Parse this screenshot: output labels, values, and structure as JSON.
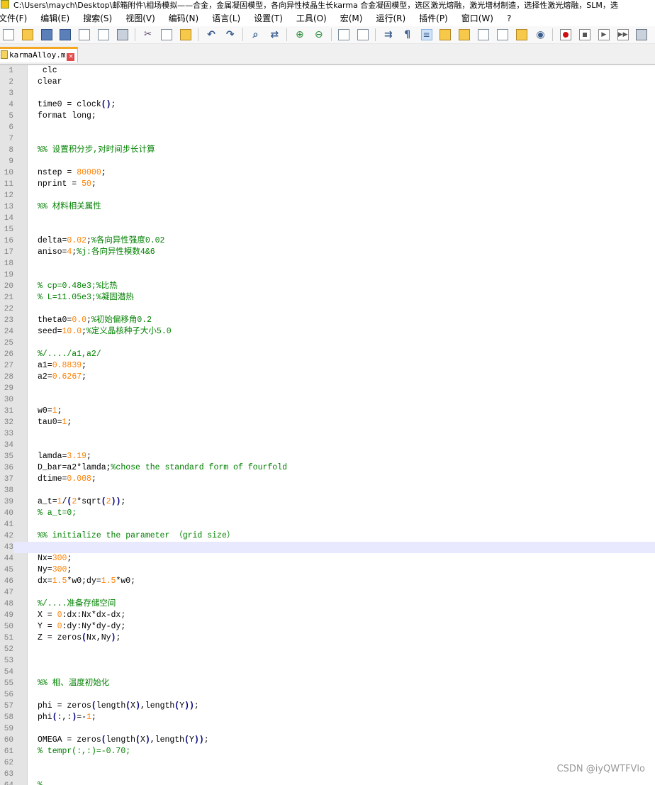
{
  "window": {
    "title": "C:\\Users\\maych\\Desktop\\邮箱附件\\相场模拟——合金，金属凝固模型，各向异性枝晶生长karma 合金凝固模型，选区激光熔融，激光增材制造，选择性激光熔融，SLM，选"
  },
  "menu": [
    "文件(F)",
    "编辑(E)",
    "搜索(S)",
    "视图(V)",
    "编码(N)",
    "语言(L)",
    "设置(T)",
    "工具(O)",
    "宏(M)",
    "运行(R)",
    "插件(P)",
    "窗口(W)",
    "?"
  ],
  "toolbar_icons": [
    "new-file-icon",
    "open-file-icon",
    "save-icon",
    "save-all-icon",
    "close-icon",
    "close-all-icon",
    "print-icon",
    "cut-icon",
    "copy-icon",
    "paste-icon",
    "undo-icon",
    "redo-icon",
    "find-icon",
    "replace-icon",
    "zoom-in-icon",
    "zoom-out-icon",
    "sync-vertical-icon",
    "sync-horizontal-icon",
    "word-wrap-icon",
    "show-all-chars-icon",
    "indent-guide-icon",
    "user-lang-icon",
    "doc-map-icon",
    "function-list-icon",
    "folder-workspace-icon",
    "monitor-icon",
    "record-macro-icon",
    "stop-macro-icon",
    "play-macro-icon",
    "play-multiple-icon",
    "save-macro-icon"
  ],
  "tab": {
    "filename": "karmaAlloy.m",
    "close": "×"
  },
  "editor": {
    "current_line": 43,
    "lines": [
      {
        "n": "1",
        "t": " clc"
      },
      {
        "n": "2",
        "t": "clear"
      },
      {
        "n": "3",
        "t": ""
      },
      {
        "n": "4",
        "t": "time0 = clock();"
      },
      {
        "n": "5",
        "t": "format long;"
      },
      {
        "n": "6",
        "t": ""
      },
      {
        "n": "7",
        "t": ""
      },
      {
        "n": "8",
        "t": "%% 设置积分步,对时间步长计算"
      },
      {
        "n": "9",
        "t": ""
      },
      {
        "n": "10",
        "t": "nstep = 80000;"
      },
      {
        "n": "11",
        "t": "nprint = 50;"
      },
      {
        "n": "12",
        "t": ""
      },
      {
        "n": "13",
        "t": "%% 材料相关属性"
      },
      {
        "n": "14",
        "t": ""
      },
      {
        "n": "15",
        "t": ""
      },
      {
        "n": "16",
        "t": "delta=0.02;%各向异性强度0.02"
      },
      {
        "n": "17",
        "t": "aniso=4;%j:各向异性模数4&6"
      },
      {
        "n": "18",
        "t": ""
      },
      {
        "n": "19",
        "t": ""
      },
      {
        "n": "20",
        "t": "% cp=0.48e3;%比热"
      },
      {
        "n": "21",
        "t": "% L=11.05e3;%凝固潜热"
      },
      {
        "n": "22",
        "t": ""
      },
      {
        "n": "23",
        "t": "theta0=0.0;%初始偏移角0.2"
      },
      {
        "n": "24",
        "t": "seed=10.0;%定义晶核种子大小5.0"
      },
      {
        "n": "25",
        "t": ""
      },
      {
        "n": "26",
        "t": "%/..../a1,a2/"
      },
      {
        "n": "27",
        "t": "a1=0.8839;"
      },
      {
        "n": "28",
        "t": "a2=0.6267;"
      },
      {
        "n": "29",
        "t": ""
      },
      {
        "n": "30",
        "t": ""
      },
      {
        "n": "31",
        "t": "w0=1;"
      },
      {
        "n": "32",
        "t": "tau0=1;"
      },
      {
        "n": "33",
        "t": ""
      },
      {
        "n": "34",
        "t": ""
      },
      {
        "n": "35",
        "t": "lamda=3.19;"
      },
      {
        "n": "36",
        "t": "D_bar=a2*lamda;%chose the standard form of fourfold"
      },
      {
        "n": "37",
        "t": "dtime=0.008;"
      },
      {
        "n": "38",
        "t": ""
      },
      {
        "n": "39",
        "t": "a_t=1/(2*sqrt(2));"
      },
      {
        "n": "40",
        "t": "% a_t=0;"
      },
      {
        "n": "41",
        "t": ""
      },
      {
        "n": "42",
        "t": "%% initialize the parameter （grid size）"
      },
      {
        "n": "43",
        "t": ""
      },
      {
        "n": "44",
        "t": "Nx=300;"
      },
      {
        "n": "45",
        "t": "Ny=300;"
      },
      {
        "n": "46",
        "t": "dx=1.5*w0;dy=1.5*w0;"
      },
      {
        "n": "47",
        "t": ""
      },
      {
        "n": "48",
        "t": "%/....准备存储空间"
      },
      {
        "n": "49",
        "t": "X = 0:dx:Nx*dx-dx;"
      },
      {
        "n": "50",
        "t": "Y = 0:dy:Ny*dy-dy;"
      },
      {
        "n": "51",
        "t": "Z = zeros(Nx,Ny);"
      },
      {
        "n": "52",
        "t": ""
      },
      {
        "n": "53",
        "t": ""
      },
      {
        "n": "54",
        "t": ""
      },
      {
        "n": "55",
        "t": "%% 相、温度初始化"
      },
      {
        "n": "56",
        "t": ""
      },
      {
        "n": "57",
        "t": "phi = zeros(length(X),length(Y));"
      },
      {
        "n": "58",
        "t": "phi(:,:)=-1;"
      },
      {
        "n": "59",
        "t": ""
      },
      {
        "n": "60",
        "t": "OMEGA = zeros(length(X),length(Y));"
      },
      {
        "n": "61",
        "t": "% tempr(:,:)=-0.70;"
      },
      {
        "n": "62",
        "t": ""
      },
      {
        "n": "63",
        "t": ""
      },
      {
        "n": "64",
        "t": "%"
      }
    ]
  },
  "watermark": "CSDN @iyQWTFVlo",
  "colors": {
    "comment": "#008000",
    "number": "#ff8000",
    "operator": "#000080",
    "line_number": "#808080",
    "gutter_bg": "#e4e4e4",
    "current_line_bg": "#e8e8ff",
    "tab_accent": "#f5a623"
  }
}
